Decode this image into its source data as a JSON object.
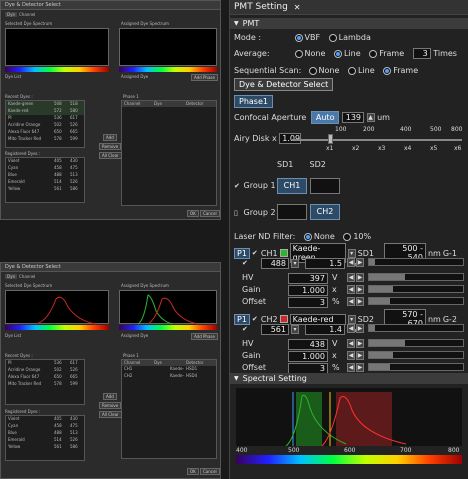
{
  "top_window": {
    "title": "Dye & Detector Select",
    "tabs": [
      "Dye",
      "Channel"
    ],
    "selected_spectrum_label": "Selected Dye Spectrum",
    "assigned_spectrum_label": "Assigned Dye Spectrum",
    "dye_list_label": "Dye List",
    "assigned_dye_label": "Assigned Dye",
    "add_phase": "Add Phase",
    "recent_dyes_label": "Recent Dyes :",
    "recent_dyes": [
      [
        "Kaede-green",
        "508",
        "518"
      ],
      [
        "Kaede-red",
        "572",
        "580"
      ],
      [
        "PI",
        "536",
        "617"
      ],
      [
        "Acridine Orange",
        "502",
        "526"
      ],
      [
        "Alexa Fluor 647",
        "650",
        "665"
      ],
      [
        "Mito Tracker Red",
        "578",
        "599"
      ]
    ],
    "registered_dyes_label": "Registered Dyes :",
    "registered_dyes": [
      [
        "Violet",
        "405",
        "430"
      ],
      [
        "Cyan",
        "458",
        "475"
      ],
      [
        "Blue",
        "488",
        "513"
      ],
      [
        "Emerald",
        "514",
        "526"
      ],
      [
        "Yellow",
        "561",
        "586"
      ]
    ],
    "phase_label": "Phase 1",
    "phase_cols": [
      "Channel",
      "Dye",
      "Detector"
    ],
    "buttons": {
      "add": "Add",
      "remove": "Remove",
      "all_clear": "All Clear",
      "ok": "OK",
      "cancel": "Cancel"
    }
  },
  "bottom_window": {
    "title": "Dye & Detector Select",
    "tabs": [
      "Dye",
      "Channel"
    ],
    "selected_spectrum_label": "Selected Dye Spectrum",
    "assigned_spectrum_label": "Assigned Dye Spectrum",
    "dye_list_label": "Dye List",
    "assigned_dye_label": "Assigned Dye",
    "add_phase": "Add Phase",
    "recent_dyes_label": "Recent Dyes :",
    "recent_dyes": [
      [
        "PI",
        "536",
        "617"
      ],
      [
        "Acridine Orange",
        "502",
        "526"
      ],
      [
        "Alexa Fluor 647",
        "650",
        "665"
      ],
      [
        "Mito Tracker Red",
        "578",
        "599"
      ]
    ],
    "registered_dyes_label": "Registered Dyes :",
    "registered_dyes": [
      [
        "Violet",
        "405",
        "430"
      ],
      [
        "Cyan",
        "458",
        "475"
      ],
      [
        "Blue",
        "488",
        "513"
      ],
      [
        "Emerald",
        "514",
        "526"
      ],
      [
        "Yellow",
        "561",
        "586"
      ]
    ],
    "phase_label": "Phase 1",
    "phase_cols": [
      "Channel",
      "Dye",
      "Detector"
    ],
    "phase_rows": [
      [
        "CH1",
        "Kaede-green",
        "HSD1"
      ],
      [
        "CH2",
        "Kaede-red",
        "HSD4"
      ]
    ],
    "buttons": {
      "add": "Add",
      "remove": "Remove",
      "all_clear": "All Clear",
      "ok": "OK",
      "cancel": "Cancel"
    }
  },
  "pmt": {
    "title": "PMT Setting",
    "pmt_section": "PMT",
    "mode_label": "Mode :",
    "mode_opts": [
      "VBF",
      "Lambda"
    ],
    "avg_label": "Average:",
    "avg_opts": [
      "None",
      "Line",
      "Frame"
    ],
    "avg_times": "3",
    "times_label": "Times",
    "seq_label": "Sequential Scan:",
    "seq_opts": [
      "None",
      "Line",
      "Frame"
    ],
    "dye_btn": "Dye & Detector Select",
    "phase_tab": "Phase1",
    "conf_label": "Confocal Aperture",
    "auto_btn": "Auto",
    "aperture_value": "139",
    "um": "um",
    "ap_ticks": [
      "100",
      "200",
      "400",
      "500",
      "800"
    ],
    "airy_label": "Airy Disk x",
    "airy_value": "1.09",
    "airy_ticks": [
      "x1",
      "x2",
      "x3",
      "x4",
      "x5",
      "x6"
    ],
    "sd1": "SD1",
    "sd2": "SD2",
    "group1": "Group 1",
    "group2": "Group 2",
    "ch1_btn": "CH1",
    "ch2_btn": "CH2",
    "laser_label": "Laser ND Filter:",
    "nd_opts": [
      "None",
      "10%"
    ],
    "channels": [
      {
        "p": "P1",
        "ch": "CH1",
        "dye": "Kaede-green",
        "sd": "SD1",
        "range": "500 - 540",
        "nm": "nm",
        "g": "G-1",
        "color": "#2db52d",
        "laser": "488",
        "pct": "1.5",
        "hv": "397",
        "gain": "1.000",
        "offset": "3",
        "pct_unit": "%",
        "hv_unit": "V",
        "gain_unit": "x",
        "offset_unit": "%"
      },
      {
        "p": "P1",
        "ch": "CH2",
        "dye": "Kaede-red",
        "sd": "SD2",
        "range": "570 - 670",
        "nm": "nm",
        "g": "G-2",
        "color": "#d02828",
        "laser": "561",
        "pct": "1.4",
        "hv": "438",
        "gain": "1.000",
        "offset": "3",
        "pct_unit": "%",
        "hv_unit": "V",
        "gain_unit": "x",
        "offset_unit": "%"
      }
    ],
    "hv_label": "HV",
    "gain_label": "Gain",
    "offset_label": "Offset",
    "spectral_section": "Spectral Setting",
    "spec_ticks": [
      "400",
      "500",
      "600",
      "700",
      "800"
    ]
  }
}
